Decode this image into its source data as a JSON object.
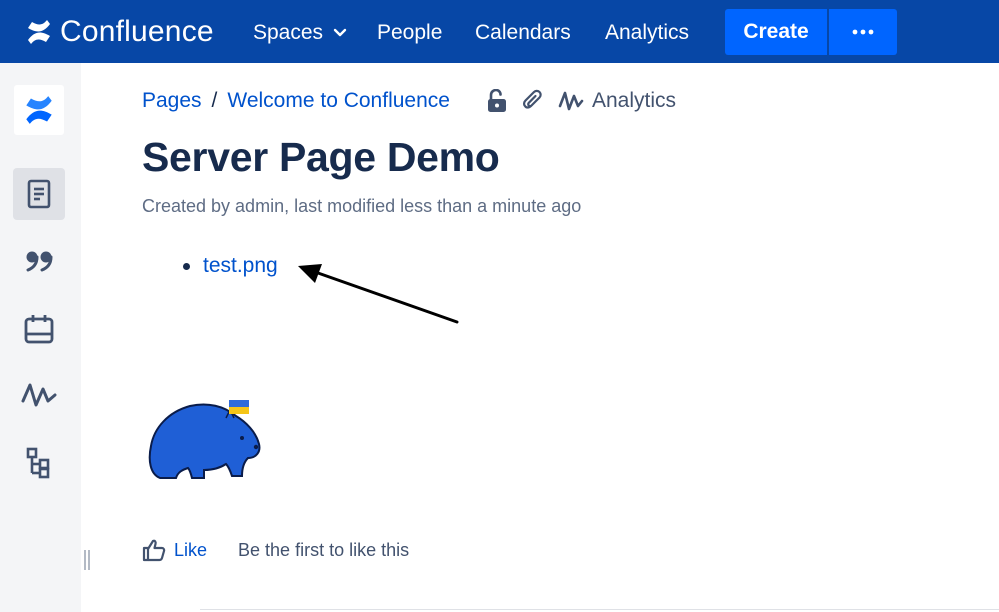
{
  "topnav": {
    "product_name": "Confluence",
    "items": [
      {
        "label": "Spaces"
      },
      {
        "label": "People"
      },
      {
        "label": "Calendars"
      },
      {
        "label": "Analytics"
      }
    ],
    "create_label": "Create",
    "more_label": "•••",
    "colors": {
      "bar": "#0747a6",
      "button": "#0065ff"
    }
  },
  "sidebar": {
    "icons": [
      "confluence-logo-icon",
      "pages-icon",
      "quote-icon",
      "calendar-icon",
      "analytics-icon",
      "page-tree-icon"
    ],
    "active": "pages-icon"
  },
  "breadcrumb": {
    "items": [
      {
        "label": "Pages"
      },
      {
        "label": "Welcome to Confluence"
      }
    ],
    "separator": "/",
    "analytics_label": "Analytics"
  },
  "page": {
    "title": "Server Page Demo",
    "byline": "Created by admin, last modified less than a minute ago",
    "attachments": [
      {
        "label": "test.png"
      }
    ]
  },
  "footer": {
    "like_label": "Like",
    "like_summary": "Be the first to like this"
  }
}
